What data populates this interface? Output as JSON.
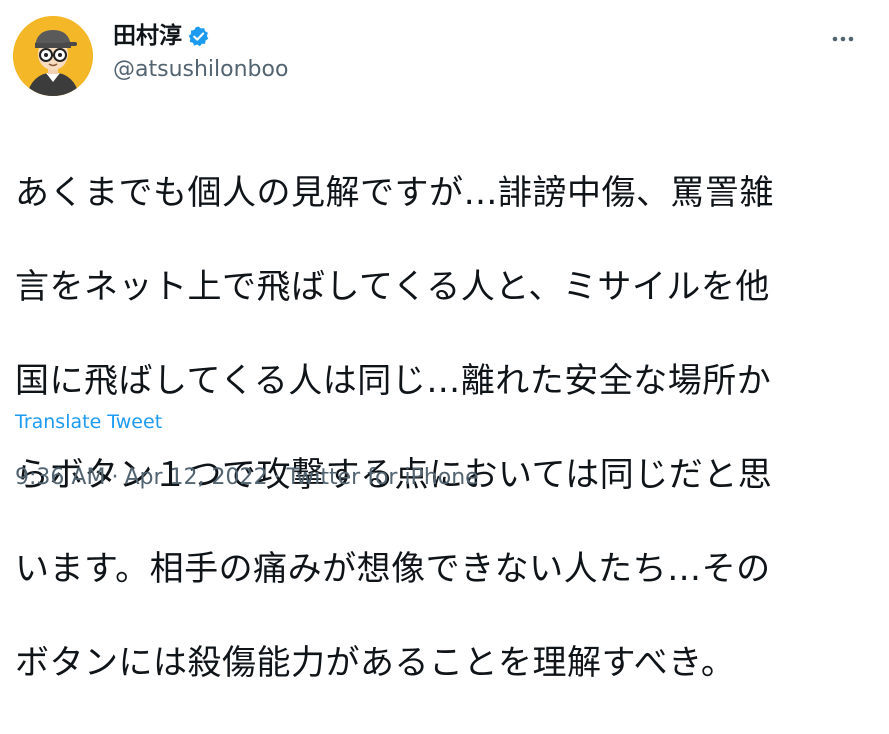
{
  "author": {
    "display_name": "田村淳",
    "handle": "@atsushilonboo",
    "verified_icon": "verified-badge-icon",
    "avatar_icon": "cartoon-avatar-icon"
  },
  "menu": {
    "icon": "more-options-icon"
  },
  "tweet": {
    "lines": [
      "あくまでも個人の見解ですが…誹謗中傷、罵詈雑",
      "言をネット上で飛ばしてくる人と、ミサイルを他",
      "国に飛ばしてくる人は同じ…離れた安全な場所か",
      "らボタン１つで攻撃する点においては同じだと思",
      "います。相手の痛みが想像できない人たち…その",
      "ボタンには殺傷能力があることを理解すべき。"
    ],
    "translate_label": "Translate Tweet"
  },
  "meta": {
    "time": "9:36 AM",
    "date": "Apr 12, 2022",
    "source": "Twitter for iPhone",
    "separator": "·"
  },
  "colors": {
    "text": "#0f1419",
    "muted": "#536471",
    "link": "#1d9bf0",
    "verified": "#1d9bf0",
    "avatar_bg": "#f4b728"
  }
}
